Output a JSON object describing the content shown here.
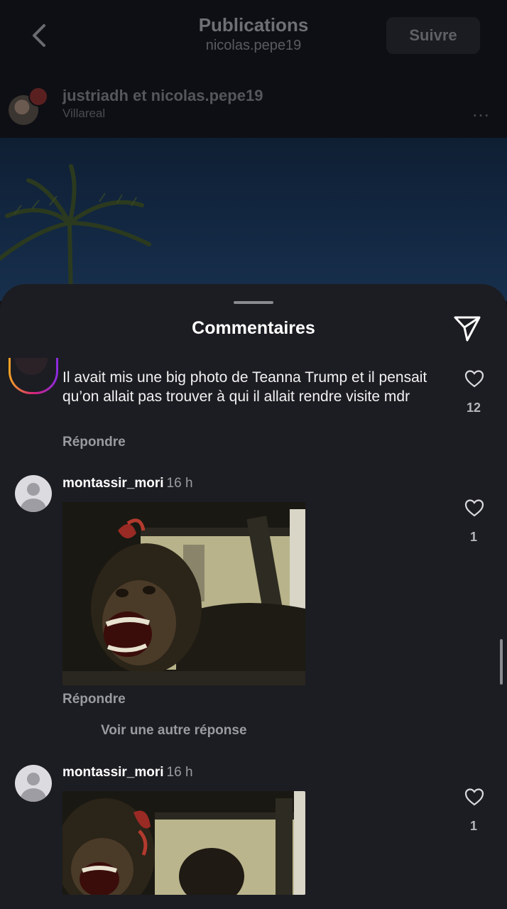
{
  "post": {
    "header": {
      "title": "Publications",
      "subtitle": "nicolas.pepe19",
      "follow_label": "Suivre"
    },
    "author": {
      "names": "justriadh et nicolas.pepe19",
      "location": "Villareal",
      "more_label": "…"
    }
  },
  "comments_sheet": {
    "title": "Commentaires",
    "comments": [
      {
        "text": "Il avait mis une big photo de Teanna Trump et il pensait qu’on allait pas trouver à qui il allait rendre visite mdr",
        "reply_label": "Répondre",
        "likes": "12"
      },
      {
        "username": "montassir_mori",
        "time": "16 h",
        "reply_label": "Répondre",
        "likes": "1",
        "see_more_label": "Voir une autre réponse"
      },
      {
        "username": "montassir_mori",
        "time": "16 h",
        "likes": "1"
      }
    ]
  },
  "colors": {
    "sheet_bg": "#1c1d22",
    "background": "#0e0f14",
    "accent_ring": "#d6247a"
  },
  "icons": [
    "chevron-left-icon",
    "more-icon",
    "send-icon",
    "heart-icon",
    "default-avatar-icon"
  ]
}
